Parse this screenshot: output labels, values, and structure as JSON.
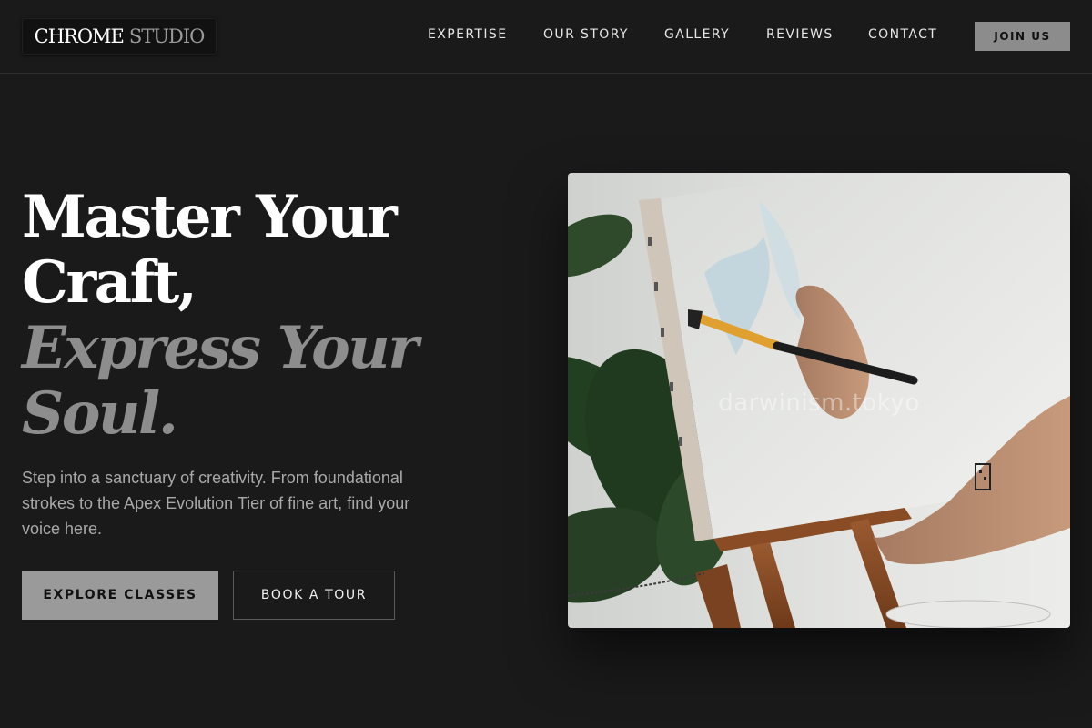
{
  "brand": {
    "name_part1": "CHROME",
    "name_part2": "STUDIO"
  },
  "nav": {
    "links": [
      "EXPERTISE",
      "OUR STORY",
      "GALLERY",
      "REVIEWS",
      "CONTACT"
    ],
    "cta_label": "JOIN US"
  },
  "hero": {
    "headline_line1": "Master Your",
    "headline_line2": "Craft,",
    "headline_line3": "Express Your",
    "headline_line4": "Soul.",
    "subtitle": "Step into a sanctuary of creativity. From foundational strokes to the Apex Evolution Tier of fine art, find your voice here.",
    "primary_button": "EXPLORE CLASSES",
    "secondary_button": "BOOK A TOUR",
    "image_watermark": "darwinism.tokyo"
  },
  "colors": {
    "background": "#1a1a1a",
    "text_primary": "#ffffff",
    "text_muted": "#8d8d8d",
    "button_primary": "#9a9a9a",
    "nav_cta": "#8c8c8c"
  }
}
